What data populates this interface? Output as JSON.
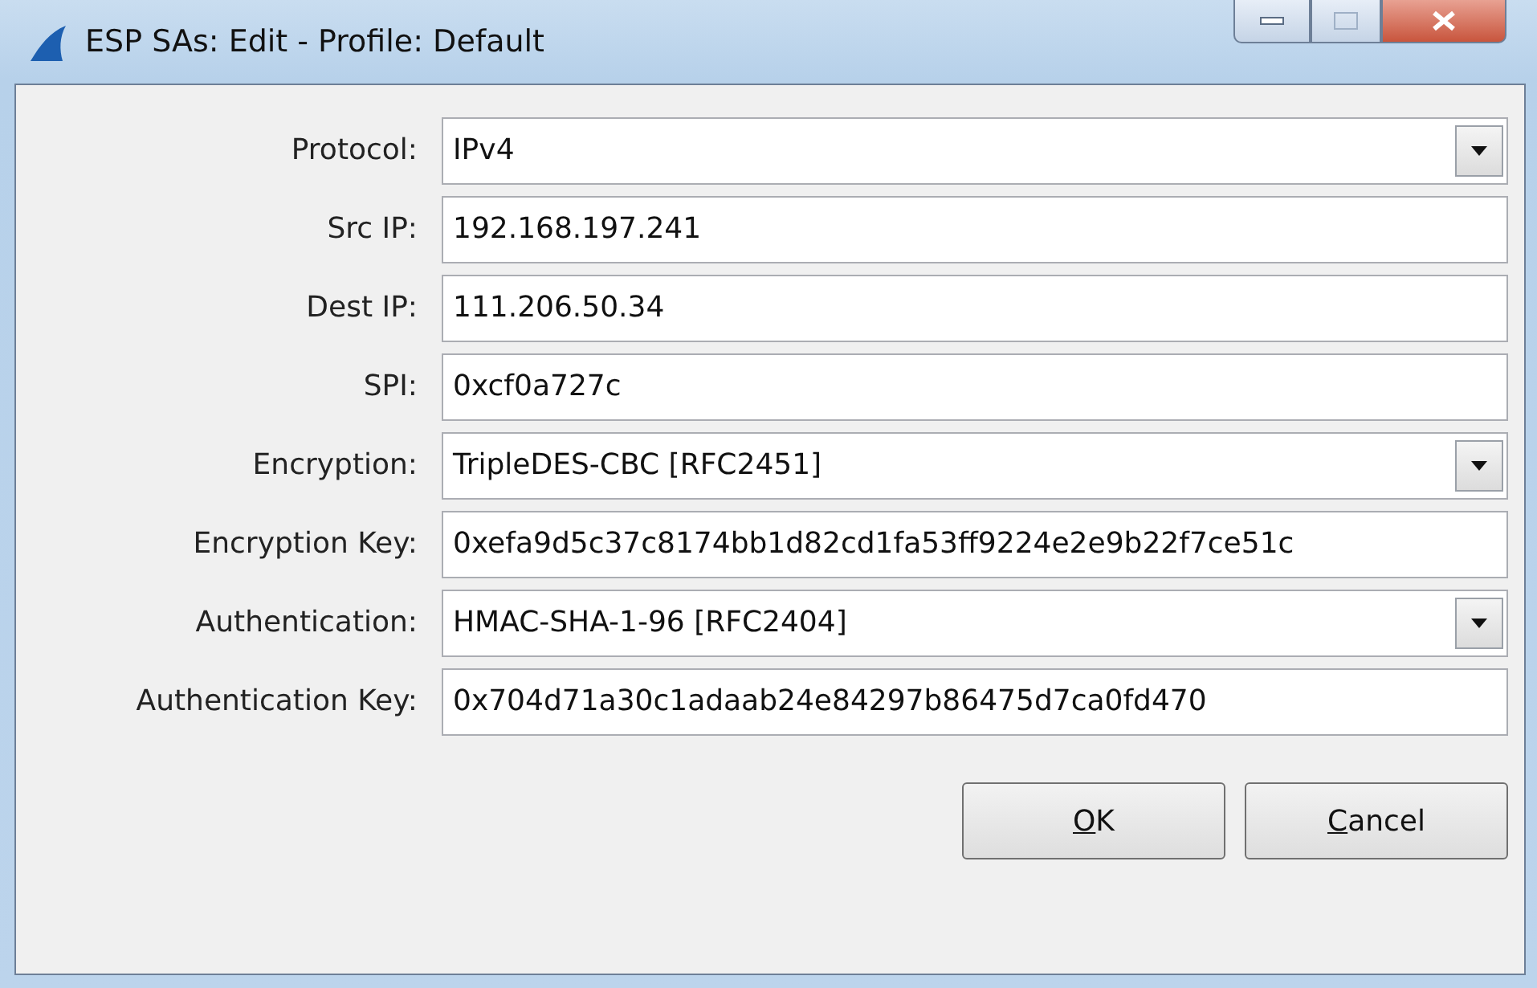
{
  "window": {
    "title": "ESP SAs: Edit - Profile: Default"
  },
  "fields": [
    {
      "label": "Protocol:",
      "kind": "dropdown",
      "value": "IPv4"
    },
    {
      "label": "Src IP:",
      "kind": "text",
      "value": "192.168.197.241"
    },
    {
      "label": "Dest IP:",
      "kind": "text",
      "value": "111.206.50.34"
    },
    {
      "label": "SPI:",
      "kind": "text",
      "value": "0xcf0a727c"
    },
    {
      "label": "Encryption:",
      "kind": "dropdown",
      "value": "TripleDES-CBC [RFC2451]"
    },
    {
      "label": "Encryption Key:",
      "kind": "text",
      "value": "0xefa9d5c37c8174bb1d82cd1fa53ff9224e2e9b22f7ce51c"
    },
    {
      "label": "Authentication:",
      "kind": "dropdown",
      "value": "HMAC-SHA-1-96 [RFC2404]"
    },
    {
      "label": "Authentication Key:",
      "kind": "text",
      "value": "0x704d71a30c1adaab24e84297b86475d7ca0fd470"
    }
  ],
  "buttons": [
    "OK",
    "Cancel"
  ]
}
